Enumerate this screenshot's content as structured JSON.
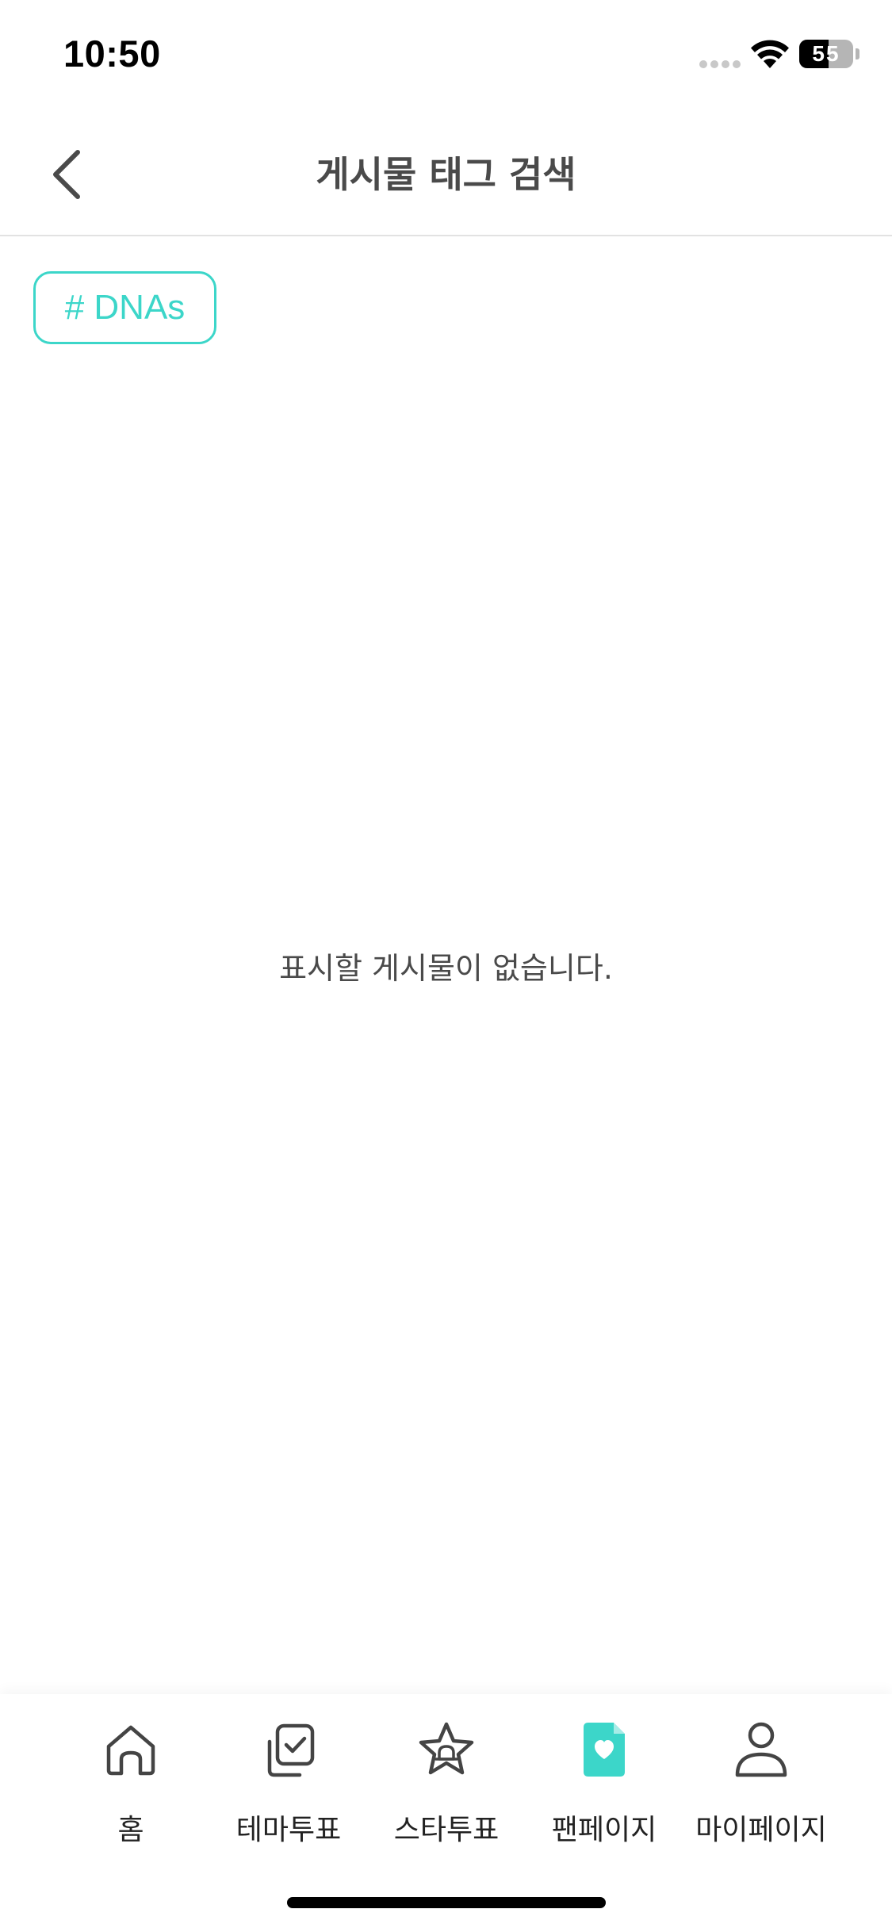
{
  "status_bar": {
    "time": "10:50",
    "battery_level": "55",
    "battery_fraction": 0.55
  },
  "header": {
    "title": "게시물 태그 검색",
    "back_icon": "chevron-left-icon"
  },
  "tag": {
    "label": "# DNAs",
    "color": "#3cd6c9"
  },
  "empty_state": {
    "message": "표시할 게시물이 없습니다."
  },
  "tab_bar": {
    "active_color": "#3cd6c9",
    "tabs": [
      {
        "label": "홈",
        "icon": "home-icon",
        "active": false
      },
      {
        "label": "테마투표",
        "icon": "theme-vote-icon",
        "active": false
      },
      {
        "label": "스타투표",
        "icon": "star-vote-icon",
        "active": false
      },
      {
        "label": "팬페이지",
        "icon": "fanpage-icon",
        "active": true
      },
      {
        "label": "마이페이지",
        "icon": "profile-icon",
        "active": false
      }
    ]
  }
}
